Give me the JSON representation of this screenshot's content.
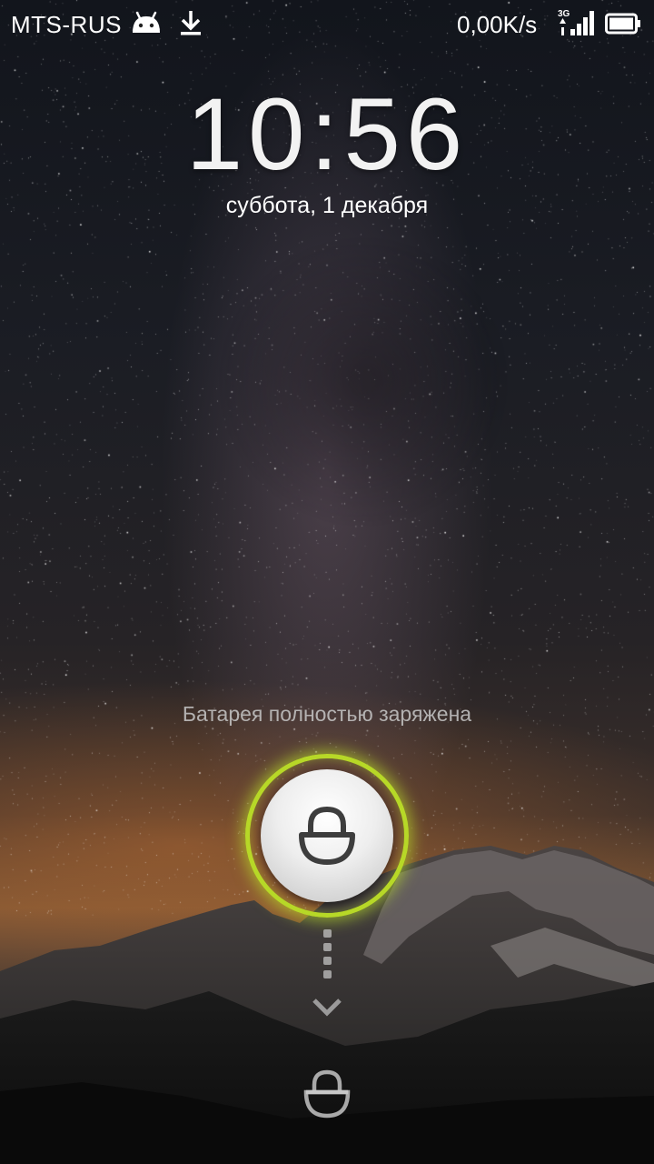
{
  "status_bar": {
    "carrier": "MTS-RUS",
    "network_speed": "0,00K/s",
    "network_type": "3G",
    "icons": [
      "android-icon",
      "download-icon",
      "signal-icon",
      "battery-icon"
    ]
  },
  "lockscreen": {
    "time": "10:56",
    "date": "суббота, 1 декабря",
    "battery_message": "Батарея полностью заряжена",
    "lock_icon": "lock-icon",
    "unlock_target_icon": "unlock-icon"
  },
  "colors": {
    "ring_accent": "#b7d827"
  }
}
